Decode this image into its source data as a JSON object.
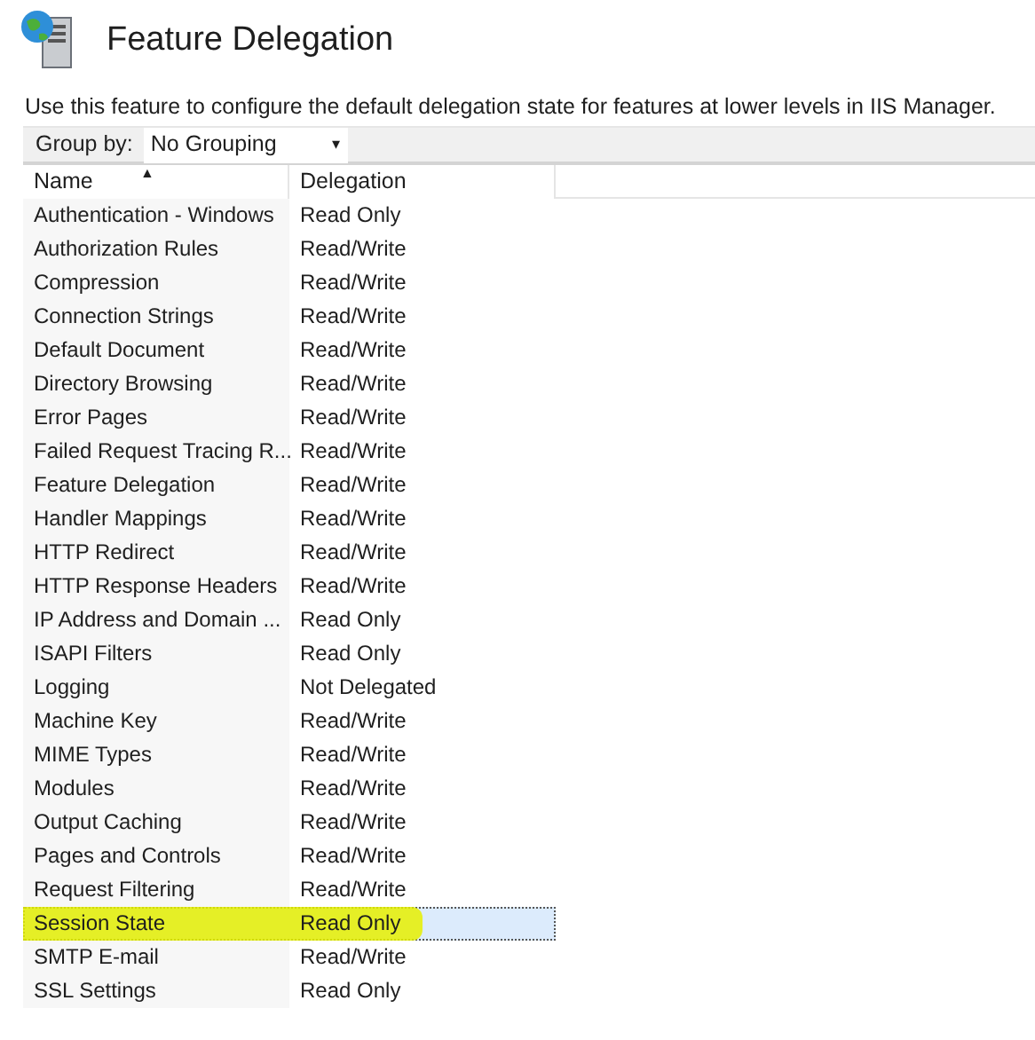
{
  "header": {
    "title": "Feature Delegation",
    "description": "Use this feature to configure the default delegation state for features at lower levels in IIS Manager."
  },
  "toolbar": {
    "group_by_label": "Group by:",
    "group_by_value": "No Grouping",
    "caret": "▾"
  },
  "table": {
    "columns": [
      {
        "label": "Name",
        "sort": "▲"
      },
      {
        "label": "Delegation"
      }
    ],
    "rows": [
      {
        "name": "Authentication - Windows",
        "delegation": "Read Only",
        "selected": false,
        "highlighted": false
      },
      {
        "name": "Authorization Rules",
        "delegation": "Read/Write",
        "selected": false,
        "highlighted": false
      },
      {
        "name": "Compression",
        "delegation": "Read/Write",
        "selected": false,
        "highlighted": false
      },
      {
        "name": "Connection Strings",
        "delegation": "Read/Write",
        "selected": false,
        "highlighted": false
      },
      {
        "name": "Default Document",
        "delegation": "Read/Write",
        "selected": false,
        "highlighted": false
      },
      {
        "name": "Directory Browsing",
        "delegation": "Read/Write",
        "selected": false,
        "highlighted": false
      },
      {
        "name": "Error Pages",
        "delegation": "Read/Write",
        "selected": false,
        "highlighted": false
      },
      {
        "name": "Failed Request Tracing R...",
        "delegation": "Read/Write",
        "selected": false,
        "highlighted": false
      },
      {
        "name": "Feature Delegation",
        "delegation": "Read/Write",
        "selected": false,
        "highlighted": false
      },
      {
        "name": "Handler Mappings",
        "delegation": "Read/Write",
        "selected": false,
        "highlighted": false
      },
      {
        "name": "HTTP Redirect",
        "delegation": "Read/Write",
        "selected": false,
        "highlighted": false
      },
      {
        "name": "HTTP Response Headers",
        "delegation": "Read/Write",
        "selected": false,
        "highlighted": false
      },
      {
        "name": "IP Address and Domain ...",
        "delegation": "Read Only",
        "selected": false,
        "highlighted": false
      },
      {
        "name": "ISAPI Filters",
        "delegation": "Read Only",
        "selected": false,
        "highlighted": false
      },
      {
        "name": "Logging",
        "delegation": "Not Delegated",
        "selected": false,
        "highlighted": false
      },
      {
        "name": "Machine Key",
        "delegation": "Read/Write",
        "selected": false,
        "highlighted": false
      },
      {
        "name": "MIME Types",
        "delegation": "Read/Write",
        "selected": false,
        "highlighted": false
      },
      {
        "name": "Modules",
        "delegation": "Read/Write",
        "selected": false,
        "highlighted": false
      },
      {
        "name": "Output Caching",
        "delegation": "Read/Write",
        "selected": false,
        "highlighted": false
      },
      {
        "name": "Pages and Controls",
        "delegation": "Read/Write",
        "selected": false,
        "highlighted": false
      },
      {
        "name": "Request Filtering",
        "delegation": "Read/Write",
        "selected": false,
        "highlighted": false
      },
      {
        "name": "Session State",
        "delegation": "Read Only",
        "selected": true,
        "highlighted": true
      },
      {
        "name": "SMTP E-mail",
        "delegation": "Read/Write",
        "selected": false,
        "highlighted": false
      },
      {
        "name": "SSL Settings",
        "delegation": "Read Only",
        "selected": false,
        "highlighted": false
      }
    ]
  }
}
